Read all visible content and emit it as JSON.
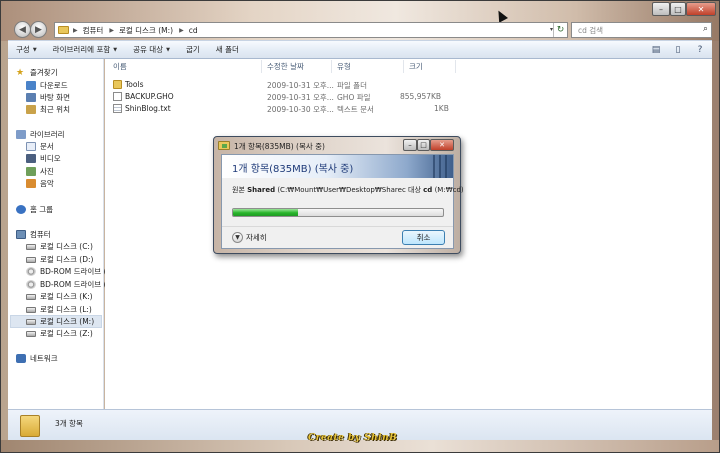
{
  "window": {
    "min": "–",
    "max": "□",
    "close": "✕"
  },
  "address": {
    "crumbs": [
      "컴퓨터",
      "로컬 디스크 (M:)",
      "cd"
    ],
    "dropdown": "▾",
    "refresh": "↻"
  },
  "search": {
    "placeholder": "cd 검색",
    "icon": "search-icon"
  },
  "toolbar": {
    "items": [
      "구성",
      "라이브러리에 포함",
      "공유 대상",
      "굽기",
      "새 폴더"
    ]
  },
  "navpane": {
    "favorites": {
      "label": "즐겨찾기",
      "items": [
        "다운로드",
        "바탕 화면",
        "최근 위치"
      ]
    },
    "libraries": {
      "label": "라이브러리",
      "items": [
        "문서",
        "비디오",
        "사진",
        "음악"
      ]
    },
    "homegroup": "홈 그룹",
    "computer": {
      "label": "컴퓨터",
      "items": [
        "로컬 디스크 (C:)",
        "로컬 디스크 (D:)",
        "BD-ROM 드라이브 (",
        "BD-ROM 드라이브 (",
        "로컬 디스크 (K:)",
        "로컬 디스크 (L:)",
        "로컬 디스크 (M:)",
        "로컬 디스크 (Z:)"
      ],
      "selected_index": 6
    },
    "network": "네트워크"
  },
  "columns": {
    "name": "이름",
    "modified": "수정한 날짜",
    "type": "유형",
    "size": "크기"
  },
  "files": [
    {
      "name": "Tools",
      "modified": "2009-10-31 오후...",
      "type": "파일 폴더",
      "size": "",
      "kind": "folder"
    },
    {
      "name": "BACKUP.GHO",
      "modified": "2009-10-31 오후...",
      "type": "GHO 파일",
      "size": "855,957KB",
      "kind": "file"
    },
    {
      "name": "ShinBlog.txt",
      "modified": "2009-10-30 오후...",
      "type": "텍스트 문서",
      "size": "1KB",
      "kind": "txt"
    }
  ],
  "status": {
    "count": "3개 항목"
  },
  "watermark": "Create by ShinB",
  "dialog": {
    "title": "1개 항목(835MB) (복사 중)",
    "heading": "1개 항목(835MB) (복사 중)",
    "src_prefix": "원본",
    "src_name": "Shared",
    "src_path": "(C:₩Mount₩User₩Desktop₩Sharec 대상",
    "dst_name": "cd",
    "dst_path": "(M:₩cd)",
    "progress": 0.31,
    "more": "자세히",
    "cancel": "취소",
    "accent": "#28b52a"
  }
}
